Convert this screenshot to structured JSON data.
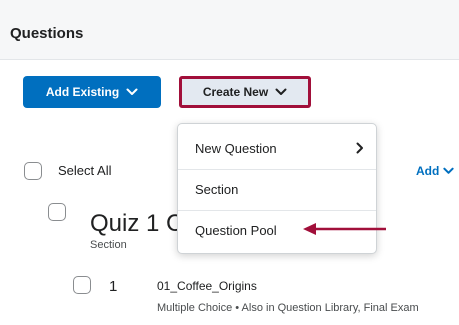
{
  "header": {
    "title": "Questions"
  },
  "toolbar": {
    "add_existing_label": "Add Existing",
    "create_new_label": "Create New"
  },
  "dropdown": {
    "items": [
      {
        "label": "New Question",
        "has_submenu": true
      },
      {
        "label": "Section"
      },
      {
        "label": "Question Pool"
      }
    ]
  },
  "list": {
    "select_all_label": "Select All",
    "add_label": "Add",
    "section": {
      "title": "Quiz 1 C",
      "type_label": "Section"
    },
    "question": {
      "number": "1",
      "title": "01_Coffee_Origins",
      "meta": "Multiple Choice  •  Also in Question Library, Final Exam"
    }
  },
  "colors": {
    "primary": "#006fbf",
    "highlight_border": "#a10f3a",
    "annotation_arrow": "#a10f3a",
    "header_bg": "#f6f7f8"
  },
  "icons": [
    "chevron-down-icon",
    "chevron-right-icon",
    "arrow-left-icon"
  ]
}
